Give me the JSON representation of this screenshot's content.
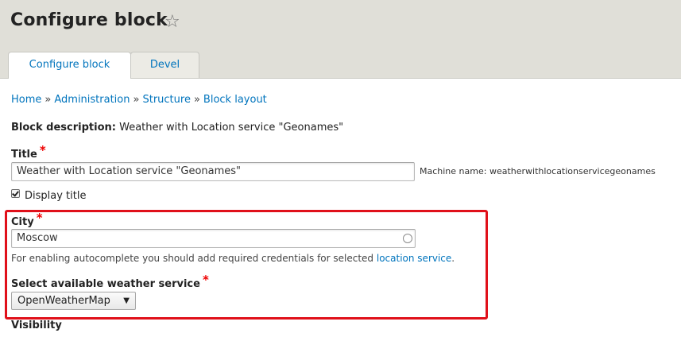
{
  "header": {
    "title": "Configure block",
    "star_icon": "☆"
  },
  "tabs": [
    {
      "label": "Configure block",
      "active": true
    },
    {
      "label": "Devel",
      "active": false
    }
  ],
  "breadcrumb": {
    "items": [
      "Home",
      "Administration",
      "Structure",
      "Block layout"
    ],
    "separator": "»"
  },
  "block_description": {
    "label": "Block description:",
    "value": "Weather with Location service \"Geonames\""
  },
  "title_field": {
    "label": "Title",
    "required_mark": "*",
    "value": "Weather with Location service \"Geonames\"",
    "machine_name": "Machine name: weatherwithlocationservicegeonames"
  },
  "display_title": {
    "label": "Display title",
    "checked": true
  },
  "city_field": {
    "label": "City",
    "required_mark": "*",
    "value": "Moscow",
    "help_text": "For enabling autocomplete you should add required credentials for selected ",
    "help_link": "location service",
    "help_end": "."
  },
  "weather_service": {
    "label": "Select available weather service",
    "required_mark": "*",
    "selected": "OpenWeatherMap",
    "caret": "▼"
  },
  "visibility": {
    "label": "Visibility"
  },
  "colors": {
    "link": "#0074bd",
    "required": "#e00000",
    "highlight_border": "#e0101a",
    "header_bg": "#e0dfd8"
  }
}
